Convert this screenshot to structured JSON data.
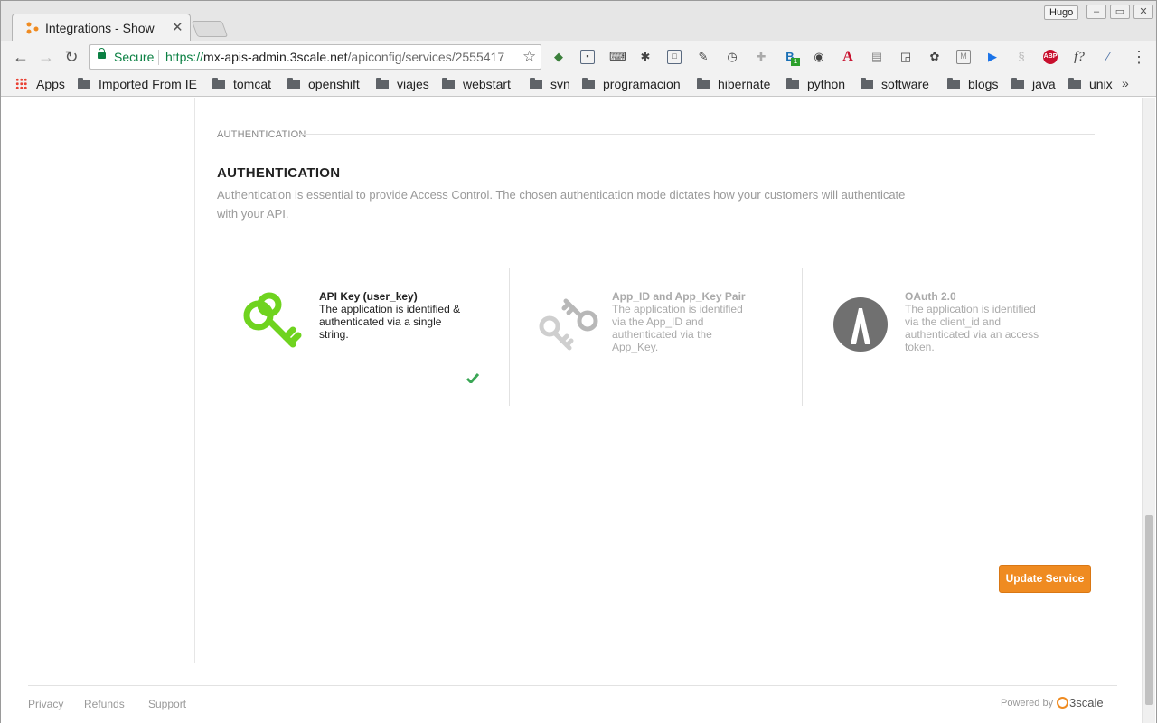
{
  "browser": {
    "tab_title": "Integrations - Show",
    "profile_name": "Hugo",
    "security_label": "Secure",
    "url_scheme": "https://",
    "url_host": "mx-apis-admin.3scale.net",
    "url_path": "/apiconfig/services/2555417",
    "bookmarks": [
      "Apps",
      "Imported From IE",
      "tomcat",
      "openshift",
      "viajes",
      "webstart",
      "svn",
      "programacion",
      "hibernate",
      "python",
      "software",
      "blogs",
      "java",
      "unix"
    ],
    "more_bookmarks": "»",
    "extension_badge": "1",
    "extension_abp": "ABP"
  },
  "page": {
    "section_label": "AUTHENTICATION",
    "heading": "AUTHENTICATION",
    "description": "Authentication is essential to provide Access Control. The chosen authentication mode dictates how your customers will authenticate with your API.",
    "options": [
      {
        "title": "API Key (user_key)",
        "desc": "The application is identified & authenticated via a single string.",
        "selected": true
      },
      {
        "title": "App_ID and App_Key Pair",
        "desc": "The application is identified via the App_ID and authenticated via the App_Key.",
        "selected": false
      },
      {
        "title": "OAuth 2.0",
        "desc": "The application is identified via the client_id and authenticated via an access token.",
        "selected": false
      }
    ],
    "update_button": "Update Service"
  },
  "footer": {
    "links": [
      "Privacy",
      "Refunds",
      "Support"
    ],
    "powered_by": "Powered by",
    "logo_text": "3scale"
  },
  "colors": {
    "accent_orange": "#ef8b21",
    "key_green": "#6fd31f",
    "check_green": "#3aa655",
    "secure_green": "#0b8043"
  }
}
